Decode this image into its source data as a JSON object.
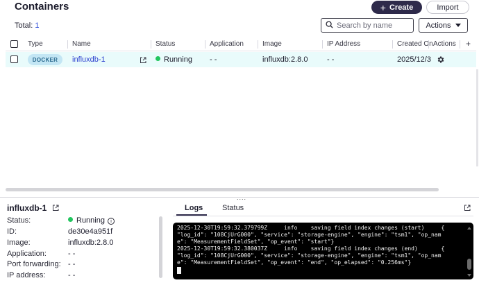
{
  "header": {
    "title": "Containers",
    "create_label": "Create",
    "import_label": "Import",
    "total_label": "Total:",
    "total_count": "1",
    "search_placeholder": "Search by name",
    "actions_label": "Actions"
  },
  "table": {
    "columns": [
      "Type",
      "Name",
      "Status",
      "Application",
      "Image",
      "IP Address",
      "Created On",
      "Actions"
    ],
    "add_column_label": "+",
    "rows": [
      {
        "type": "DOCKER",
        "name": "influxdb-1",
        "status": "Running",
        "application": "- -",
        "image": "influxdb:2.8.0",
        "ip_address": "- -",
        "created_on": "2025/12/3"
      }
    ]
  },
  "detail": {
    "title": "influxdb-1",
    "grip": "....",
    "fields": [
      {
        "label": "Status:",
        "value": "Running"
      },
      {
        "label": "ID:",
        "value": "de30e4a951f"
      },
      {
        "label": "Image:",
        "value": "influxdb:2.8.0"
      },
      {
        "label": "Application:",
        "value": "- -"
      },
      {
        "label": "Port forwarding:",
        "value": "- -"
      },
      {
        "label": "IP address:",
        "value": "- -"
      }
    ],
    "info_glyph": "i",
    "tabs": [
      "Logs",
      "Status"
    ],
    "active_tab": "Logs",
    "log_lines": [
      "2025-12-30T19:59:32.379799Z     info    saving field index changes (start)     {",
      "\"log_id\": \"108CjUrG000\", \"service\": \"storage-engine\", \"engine\": \"tsm1\", \"op_nam",
      "e\": \"MeasurementFieldSet\", \"op_event\": \"start\"}",
      "2025-12-30T19:59:32.380037Z     info    saving field index changes (end)       {",
      "\"log_id\": \"108CjUrG000\", \"service\": \"storage-engine\", \"engine\": \"tsm1\", \"op_nam",
      "e\": \"MeasurementFieldSet\", \"op_event\": \"end\", \"op_elapsed\": \"0.256ms\"}"
    ]
  },
  "colors": {
    "primary": "#2e2a4a",
    "link": "#2b3fcf",
    "running": "#22c55e",
    "row_highlight": "#e9fbfb",
    "docker_pill": "#c3e6f4"
  },
  "icons": {
    "search": "search-icon",
    "external_link": "external-link-icon",
    "gear": "gear-icon",
    "info": "info-icon"
  }
}
